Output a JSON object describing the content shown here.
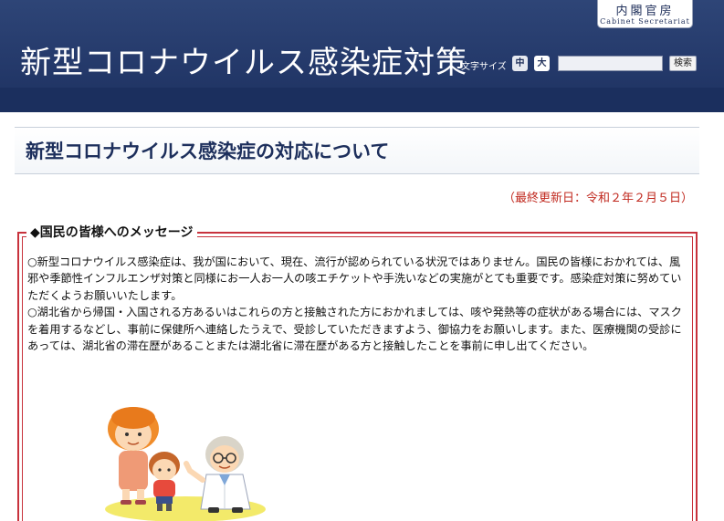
{
  "header": {
    "site_title": "新型コロナウイルス感染症対策",
    "cabinet_jp": "内閣官房",
    "cabinet_en": "Cabinet Secretariat",
    "font_size_label": "文字サイズ",
    "size_medium": "中",
    "size_large": "大",
    "search_value": "",
    "search_button": "検索"
  },
  "page": {
    "title": "新型コロナウイルス感染症の対応について",
    "last_updated": "（最終更新日：令和２年２月５日）"
  },
  "message": {
    "heading": "◆国民の皆様へのメッセージ",
    "paragraphs": [
      "○新型コロナウイルス感染症は、我が国において、現在、流行が認められている状況ではありません。国民の皆様におかれては、風邪や季節性インフルエンザ対策と同様にお一人お一人の咳エチケットや手洗いなどの実施がとても重要です。感染症対策に努めていただくようお願いいたします。",
      "○湖北省から帰国・入国される方あるいはこれらの方と接触された方におかれましては、咳や発熱等の症状がある場合には、マスクを着用するなどし、事前に保健所へ連絡したうえで、受診していただきますよう、御協力をお願いします。また、医療機関の受診にあっては、湖北省の滞在歴があることまたは湖北省に滞在歴がある方と接触したことを事前に申し出てください。"
    ]
  },
  "colors": {
    "header_bg": "#24396a",
    "title_text": "#1d2f5c",
    "accent_red": "#c8323c",
    "updated_red": "#c0281e"
  },
  "icons": {
    "illustration": "doctor-patient-illustration"
  }
}
